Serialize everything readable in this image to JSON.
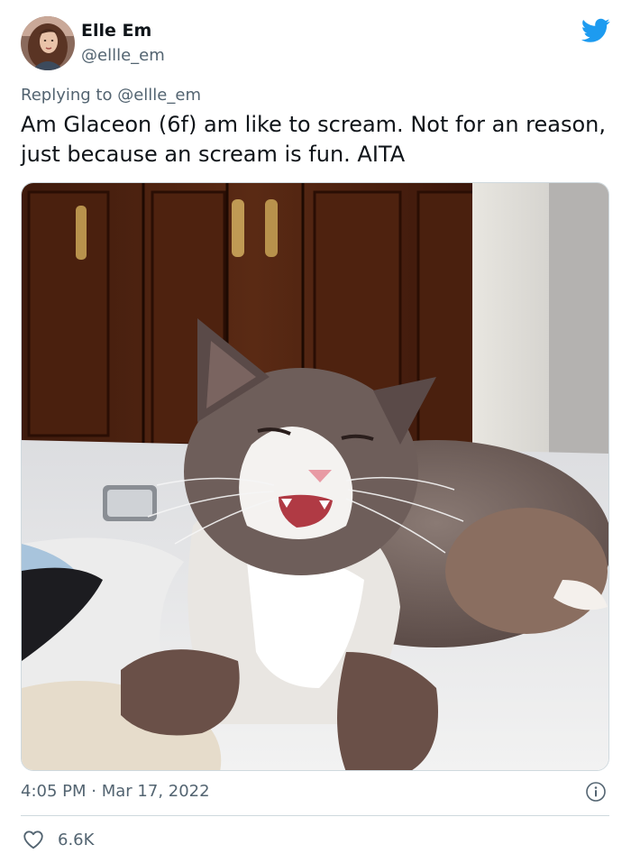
{
  "author": {
    "name": "Elle Em",
    "handle": "@ellle_em",
    "avatar_icon": "profile-photo"
  },
  "brand": {
    "icon": "twitter-bird-icon",
    "color": "#1d9bf0"
  },
  "reply": {
    "prefix": "Replying to",
    "handle": "@ellle_em"
  },
  "tweet": {
    "text": "Am Glaceon (6f) am like to scream. Not for an reason, just because an scream is fun. AITA"
  },
  "media": {
    "icon": "photo-of-screaming-gray-white-cat-on-bed"
  },
  "meta": {
    "time": "4:05 PM",
    "separator": "·",
    "date": "Mar 17, 2022",
    "info_icon": "info-icon"
  },
  "actions": {
    "like_icon": "heart-icon",
    "like_count": "6.6K"
  },
  "colors": {
    "text_primary": "#0f1419",
    "text_secondary": "#536471",
    "divider": "#cfd9de"
  }
}
